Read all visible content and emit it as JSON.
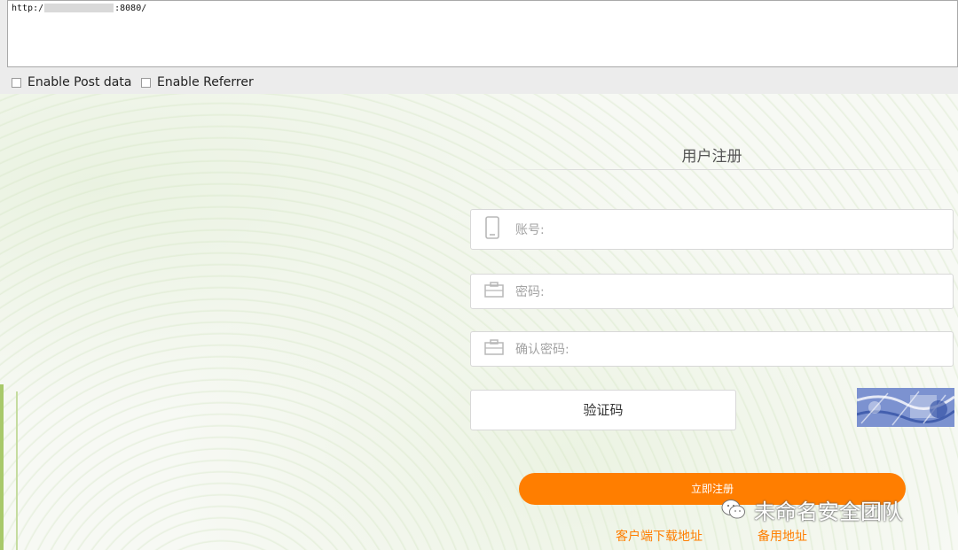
{
  "browser": {
    "url_prefix": "http:/",
    "url_suffix": ":8080/",
    "options": [
      {
        "label": "Enable Post data",
        "checked": false
      },
      {
        "label": "Enable Referrer",
        "checked": false
      }
    ]
  },
  "form": {
    "title": "用户注册",
    "fields": [
      {
        "placeholder": "账号:",
        "icon": "phone-icon"
      },
      {
        "placeholder": "密码:",
        "icon": "briefcase-icon"
      },
      {
        "placeholder": "确认密码:",
        "icon": "briefcase-icon"
      }
    ],
    "captcha_label": "验证码",
    "submit_label": "立即注册",
    "links": {
      "client_download": "客户端下载地址",
      "backup": "备用地址"
    }
  },
  "watermark": {
    "text": "未命名安全团队",
    "icon": "wechat-icon"
  },
  "colors": {
    "accent": "#ff7e00",
    "toolbar_bg": "#ececec",
    "page_bg": "#f7f9f4"
  }
}
